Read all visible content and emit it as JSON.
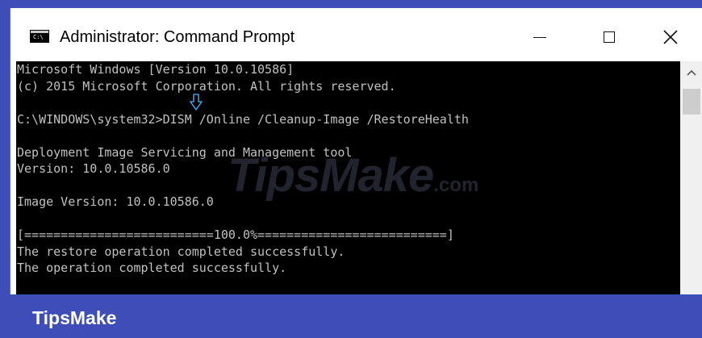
{
  "window": {
    "title": "Administrator: Command Prompt",
    "icon": "cmd-icon",
    "icon_label": "C:\\",
    "buttons": {
      "minimize": "minimize-icon",
      "maximize": "maximize-icon",
      "close": "close-icon"
    }
  },
  "console": {
    "lines": [
      "Microsoft Windows [Version 10.0.10586]",
      "(c) 2015 Microsoft Corporation. All rights reserved.",
      "",
      "C:\\WINDOWS\\system32>DISM /Online /Cleanup-Image /RestoreHealth",
      "",
      "Deployment Image Servicing and Management tool",
      "Version: 10.0.10586.0",
      "",
      "Image Version: 10.0.10586.0",
      "",
      "[==========================100.0%==========================]",
      "The restore operation completed successfully.",
      "The operation completed successfully."
    ],
    "background": "#000000",
    "foreground": "#c0c0c0"
  },
  "watermark": {
    "text": "TipsMake",
    "suffix": ".com"
  },
  "banner": {
    "logo": "TipsMake",
    "color": "#3f4db8"
  }
}
